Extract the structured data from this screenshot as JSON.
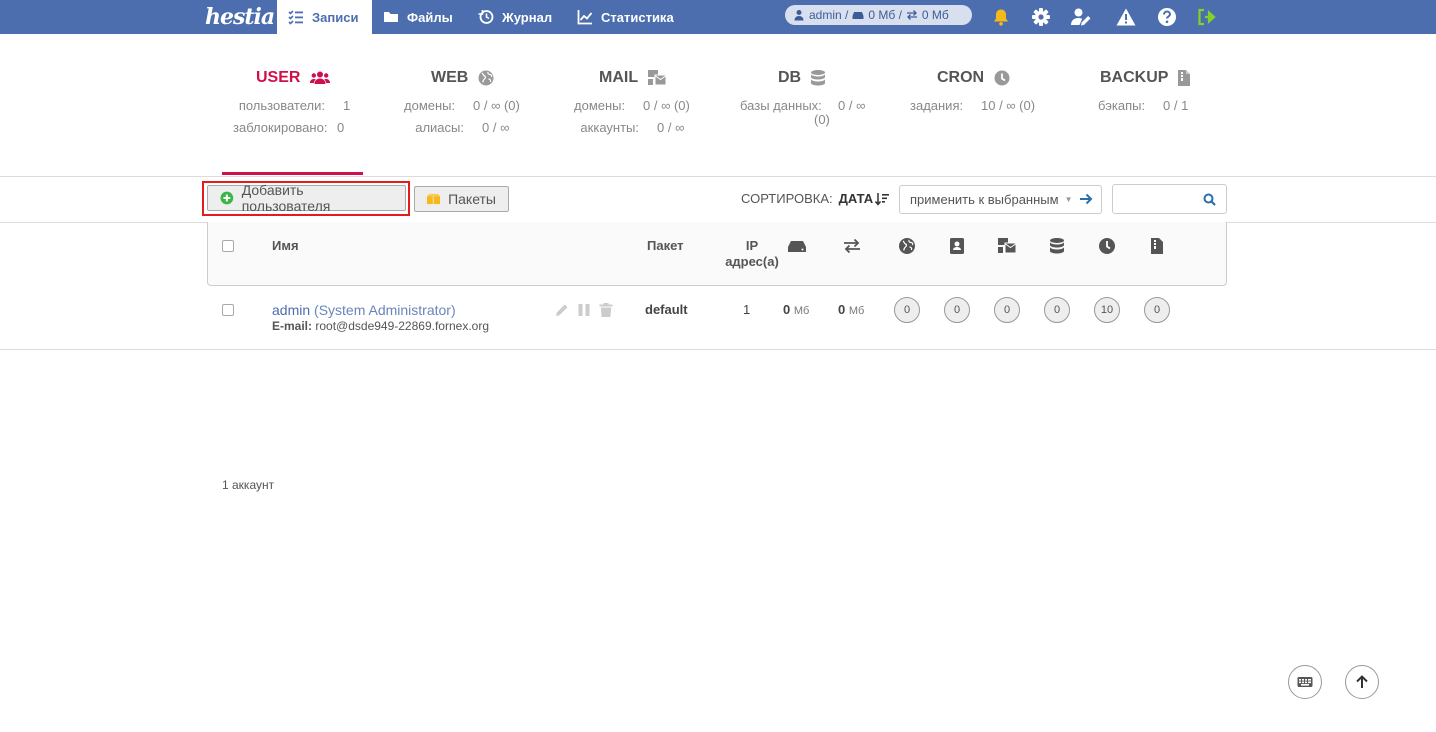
{
  "app": {
    "logo_text": "hestia"
  },
  "nav": [
    {
      "label": "Записи",
      "icon": "list-check-icon",
      "active": true
    },
    {
      "label": "Файлы",
      "icon": "folder-icon",
      "active": false
    },
    {
      "label": "Журнал",
      "icon": "history-icon",
      "active": false
    },
    {
      "label": "Статистика",
      "icon": "chart-line-icon",
      "active": false
    }
  ],
  "usage": {
    "user": "admin /",
    "disk": "0 Мб /",
    "bandwidth": "0 Мб"
  },
  "top_icons": [
    "bell-icon",
    "gear-icon",
    "user-edit-icon",
    "warning-icon",
    "help-icon",
    "logout-icon"
  ],
  "stats": [
    {
      "title": "USER",
      "icon": "users-icon",
      "rows": [
        {
          "k": "пользователи:",
          "v": "1"
        },
        {
          "k": "заблокировано:",
          "v": "0"
        }
      ]
    },
    {
      "title": "WEB",
      "icon": "globe-icon",
      "rows": [
        {
          "k": "домены:",
          "v": "0 / ∞ (0)"
        },
        {
          "k": "алиасы:",
          "v": "0 / ∞"
        }
      ]
    },
    {
      "title": "MAIL",
      "icon": "mail-bulk-icon",
      "rows": [
        {
          "k": "домены:",
          "v": "0 / ∞ (0)"
        },
        {
          "k": "аккаунты:",
          "v": "0 / ∞"
        }
      ]
    },
    {
      "title": "DB",
      "icon": "database-icon",
      "rows": [
        {
          "k": "базы данных:",
          "v": "0 / ∞"
        },
        {
          "k": "",
          "v": "(0)"
        }
      ]
    },
    {
      "title": "CRON",
      "icon": "clock-icon",
      "rows": [
        {
          "k": "задания:",
          "v": "10 / ∞ (0)"
        }
      ]
    },
    {
      "title": "BACKUP",
      "icon": "file-archive-icon",
      "rows": [
        {
          "k": "бэкапы:",
          "v": "0 / 1"
        }
      ]
    }
  ],
  "toolbar": {
    "add_user": "Добавить пользователя",
    "packages": "Пакеты",
    "sort_label": "СОРТИРОВКА:",
    "sort_value": "ДАТА",
    "apply_label": "применить к выбранным"
  },
  "table": {
    "headers": {
      "name": "Имя",
      "package": "Пакет",
      "ip_line1": "IP",
      "ip_line2": "адрес(а)"
    },
    "rows": [
      {
        "username": "admin",
        "fullname": "(System Administrator)",
        "email_label": "E-mail:",
        "email": "root@dsde949-22869.fornex.org",
        "package": "default",
        "ips": "1",
        "disk": "0",
        "disk_unit": "Мб",
        "bandwidth": "0",
        "bandwidth_unit": "Мб",
        "web": "0",
        "dns": "0",
        "mail": "0",
        "db": "0",
        "cron": "10",
        "backup": "0"
      }
    ]
  },
  "footer": {
    "count": "1 аккаунт"
  },
  "colors": {
    "topbar": "#4c6eae",
    "accent_user": "#d0104a",
    "highlight": "#e31c1c"
  }
}
